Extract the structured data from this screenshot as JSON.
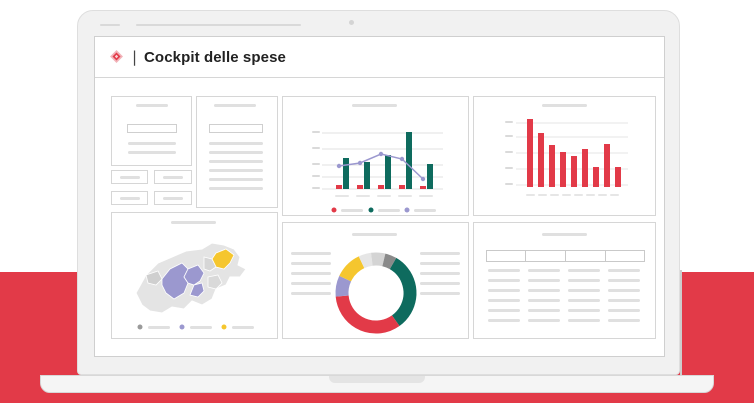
{
  "app": {
    "title": "Cockpit delle spese",
    "separator": "|",
    "logo_icon": "diamond-logo-icon"
  },
  "colors": {
    "brand_red": "#e23a48",
    "teal": "#0e6b5e",
    "lavender": "#9b98cf",
    "yellow": "#f5c62e",
    "gray": "#8a8a8a",
    "light_gray": "#e0e0e0"
  },
  "widgets": {
    "combo_chart": {
      "type": "bar+line",
      "legend_colors": [
        "#e23a48",
        "#0e6b5e",
        "#9b98cf"
      ]
    },
    "bar_chart": {
      "type": "bar",
      "color": "#e23a48"
    },
    "map": {
      "type": "choropleth",
      "legend_colors": [
        "#9a9a9a",
        "#9b98cf",
        "#f5c62e"
      ]
    },
    "donut": {
      "type": "donut",
      "segment_colors": [
        "#0e6b5e",
        "#e23a48",
        "#9b98cf",
        "#f5c62e",
        "#e6e6e6",
        "#d4d4d4",
        "#8a8a8a"
      ]
    },
    "table": {
      "type": "table"
    }
  }
}
